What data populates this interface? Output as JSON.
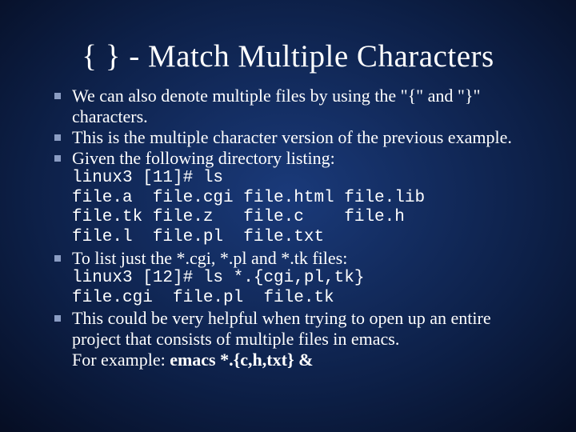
{
  "slide": {
    "title": "{ } - Match Multiple Characters",
    "items": [
      {
        "kind": "bullet",
        "html": "We can also denote multiple files by using the \"{\" and \"}\" characters."
      },
      {
        "kind": "bullet",
        "html": "This is the multiple character version of the previous example."
      },
      {
        "kind": "bullet",
        "html": "Given the following directory listing:"
      },
      {
        "kind": "mono",
        "html": "linux3 [11]# ls"
      },
      {
        "kind": "mono",
        "html": "file.a&nbsp;&nbsp;file.cgi file.html file.lib"
      },
      {
        "kind": "mono",
        "html": "file.tk file.z&nbsp;&nbsp;&nbsp;file.c&nbsp;&nbsp;&nbsp;&nbsp;file.h"
      },
      {
        "kind": "mono",
        "html": "file.l&nbsp;&nbsp;file.pl&nbsp;&nbsp;file.txt"
      },
      {
        "kind": "bullet",
        "html": "To list just the *.cgi, *.pl and *.tk files:"
      },
      {
        "kind": "mono",
        "html": "linux3 [12]# ls *.{cgi,pl,tk}"
      },
      {
        "kind": "mono",
        "html": "file.cgi&nbsp;&nbsp;file.pl&nbsp;&nbsp;file.tk"
      },
      {
        "kind": "bullet",
        "html": "This could be very helpful when trying to open up an entire project that consists of multiple files in emacs."
      },
      {
        "kind": "plain",
        "html": "For example: <strong>emacs *.{c,h,txt} &amp;</strong>"
      }
    ]
  }
}
